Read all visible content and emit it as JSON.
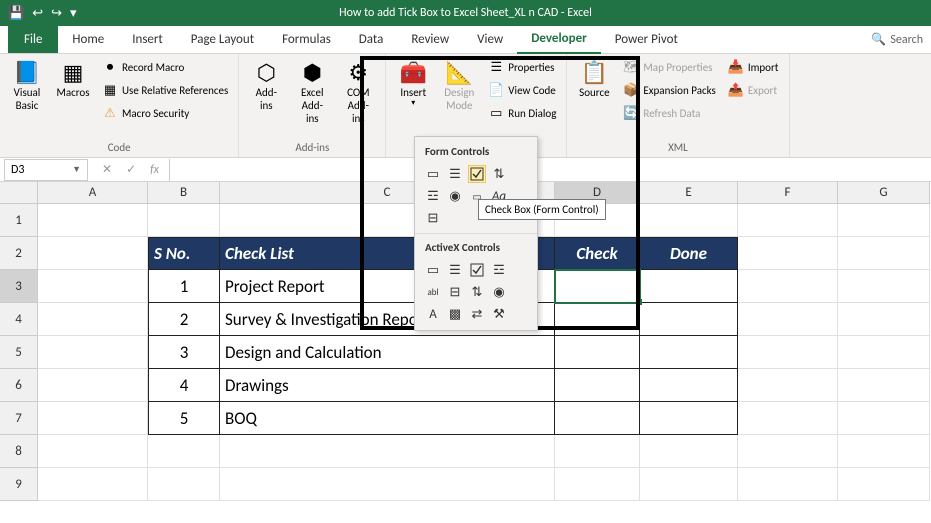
{
  "title": "How to add Tick Box to Excel Sheet_XL n CAD  -  Excel",
  "menu": {
    "file": "File",
    "home": "Home",
    "insert": "Insert",
    "pagelayout": "Page Layout",
    "formulas": "Formulas",
    "data": "Data",
    "review": "Review",
    "view": "View",
    "developer": "Developer",
    "powerpivot": "Power Pivot",
    "search": "Search"
  },
  "ribbon": {
    "code": {
      "visual_basic": "Visual Basic",
      "macros": "Macros",
      "record_macro": "Record Macro",
      "use_relative": "Use Relative References",
      "macro_security": "Macro Security",
      "label": "Code"
    },
    "addins": {
      "addins": "Add-ins",
      "excel_addins": "Excel Add-ins",
      "com_addins": "COM Add-ins",
      "label": "Add-ins"
    },
    "controls": {
      "insert": "Insert",
      "design_mode": "Design Mode",
      "properties": "Properties",
      "view_code": "View Code",
      "run_dialog": "Run Dialog"
    },
    "xml": {
      "source": "Source",
      "map_properties": "Map Properties",
      "expansion_packs": "Expansion Packs",
      "refresh_data": "Refresh Data",
      "import": "Import",
      "export": "Export",
      "label": "XML"
    }
  },
  "namebox": "D3",
  "dropdown": {
    "form_controls": "Form Controls",
    "activex_controls": "ActiveX Controls"
  },
  "tooltip": "Check Box (Form Control)",
  "columns": [
    "A",
    "B",
    "C",
    "D",
    "E",
    "F",
    "G"
  ],
  "rows": [
    "1",
    "2",
    "3",
    "4",
    "5",
    "6",
    "7",
    "8",
    "9"
  ],
  "table": {
    "headers": {
      "sno": "S No.",
      "checklist": "Check List",
      "check": "Check",
      "done": "Done"
    },
    "rows": [
      {
        "sno": "1",
        "item": "Project Report"
      },
      {
        "sno": "2",
        "item": "Survey & Investigation Report"
      },
      {
        "sno": "3",
        "item": "Design and Calculation"
      },
      {
        "sno": "4",
        "item": "Drawings"
      },
      {
        "sno": "5",
        "item": "BOQ"
      }
    ]
  }
}
